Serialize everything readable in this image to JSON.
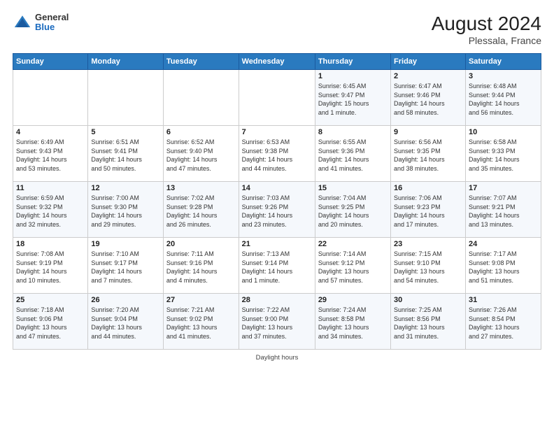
{
  "header": {
    "logo_general": "General",
    "logo_blue": "Blue",
    "main_title": "August 2024",
    "subtitle": "Plessala, France"
  },
  "footer": {
    "daylight_label": "Daylight hours"
  },
  "calendar": {
    "days_of_week": [
      "Sunday",
      "Monday",
      "Tuesday",
      "Wednesday",
      "Thursday",
      "Friday",
      "Saturday"
    ],
    "weeks": [
      [
        {
          "day": "",
          "info": ""
        },
        {
          "day": "",
          "info": ""
        },
        {
          "day": "",
          "info": ""
        },
        {
          "day": "",
          "info": ""
        },
        {
          "day": "1",
          "info": "Sunrise: 6:45 AM\nSunset: 9:47 PM\nDaylight: 15 hours\nand 1 minute."
        },
        {
          "day": "2",
          "info": "Sunrise: 6:47 AM\nSunset: 9:46 PM\nDaylight: 14 hours\nand 58 minutes."
        },
        {
          "day": "3",
          "info": "Sunrise: 6:48 AM\nSunset: 9:44 PM\nDaylight: 14 hours\nand 56 minutes."
        }
      ],
      [
        {
          "day": "4",
          "info": "Sunrise: 6:49 AM\nSunset: 9:43 PM\nDaylight: 14 hours\nand 53 minutes."
        },
        {
          "day": "5",
          "info": "Sunrise: 6:51 AM\nSunset: 9:41 PM\nDaylight: 14 hours\nand 50 minutes."
        },
        {
          "day": "6",
          "info": "Sunrise: 6:52 AM\nSunset: 9:40 PM\nDaylight: 14 hours\nand 47 minutes."
        },
        {
          "day": "7",
          "info": "Sunrise: 6:53 AM\nSunset: 9:38 PM\nDaylight: 14 hours\nand 44 minutes."
        },
        {
          "day": "8",
          "info": "Sunrise: 6:55 AM\nSunset: 9:36 PM\nDaylight: 14 hours\nand 41 minutes."
        },
        {
          "day": "9",
          "info": "Sunrise: 6:56 AM\nSunset: 9:35 PM\nDaylight: 14 hours\nand 38 minutes."
        },
        {
          "day": "10",
          "info": "Sunrise: 6:58 AM\nSunset: 9:33 PM\nDaylight: 14 hours\nand 35 minutes."
        }
      ],
      [
        {
          "day": "11",
          "info": "Sunrise: 6:59 AM\nSunset: 9:32 PM\nDaylight: 14 hours\nand 32 minutes."
        },
        {
          "day": "12",
          "info": "Sunrise: 7:00 AM\nSunset: 9:30 PM\nDaylight: 14 hours\nand 29 minutes."
        },
        {
          "day": "13",
          "info": "Sunrise: 7:02 AM\nSunset: 9:28 PM\nDaylight: 14 hours\nand 26 minutes."
        },
        {
          "day": "14",
          "info": "Sunrise: 7:03 AM\nSunset: 9:26 PM\nDaylight: 14 hours\nand 23 minutes."
        },
        {
          "day": "15",
          "info": "Sunrise: 7:04 AM\nSunset: 9:25 PM\nDaylight: 14 hours\nand 20 minutes."
        },
        {
          "day": "16",
          "info": "Sunrise: 7:06 AM\nSunset: 9:23 PM\nDaylight: 14 hours\nand 17 minutes."
        },
        {
          "day": "17",
          "info": "Sunrise: 7:07 AM\nSunset: 9:21 PM\nDaylight: 14 hours\nand 13 minutes."
        }
      ],
      [
        {
          "day": "18",
          "info": "Sunrise: 7:08 AM\nSunset: 9:19 PM\nDaylight: 14 hours\nand 10 minutes."
        },
        {
          "day": "19",
          "info": "Sunrise: 7:10 AM\nSunset: 9:17 PM\nDaylight: 14 hours\nand 7 minutes."
        },
        {
          "day": "20",
          "info": "Sunrise: 7:11 AM\nSunset: 9:16 PM\nDaylight: 14 hours\nand 4 minutes."
        },
        {
          "day": "21",
          "info": "Sunrise: 7:13 AM\nSunset: 9:14 PM\nDaylight: 14 hours\nand 1 minute."
        },
        {
          "day": "22",
          "info": "Sunrise: 7:14 AM\nSunset: 9:12 PM\nDaylight: 13 hours\nand 57 minutes."
        },
        {
          "day": "23",
          "info": "Sunrise: 7:15 AM\nSunset: 9:10 PM\nDaylight: 13 hours\nand 54 minutes."
        },
        {
          "day": "24",
          "info": "Sunrise: 7:17 AM\nSunset: 9:08 PM\nDaylight: 13 hours\nand 51 minutes."
        }
      ],
      [
        {
          "day": "25",
          "info": "Sunrise: 7:18 AM\nSunset: 9:06 PM\nDaylight: 13 hours\nand 47 minutes."
        },
        {
          "day": "26",
          "info": "Sunrise: 7:20 AM\nSunset: 9:04 PM\nDaylight: 13 hours\nand 44 minutes."
        },
        {
          "day": "27",
          "info": "Sunrise: 7:21 AM\nSunset: 9:02 PM\nDaylight: 13 hours\nand 41 minutes."
        },
        {
          "day": "28",
          "info": "Sunrise: 7:22 AM\nSunset: 9:00 PM\nDaylight: 13 hours\nand 37 minutes."
        },
        {
          "day": "29",
          "info": "Sunrise: 7:24 AM\nSunset: 8:58 PM\nDaylight: 13 hours\nand 34 minutes."
        },
        {
          "day": "30",
          "info": "Sunrise: 7:25 AM\nSunset: 8:56 PM\nDaylight: 13 hours\nand 31 minutes."
        },
        {
          "day": "31",
          "info": "Sunrise: 7:26 AM\nSunset: 8:54 PM\nDaylight: 13 hours\nand 27 minutes."
        }
      ]
    ]
  }
}
